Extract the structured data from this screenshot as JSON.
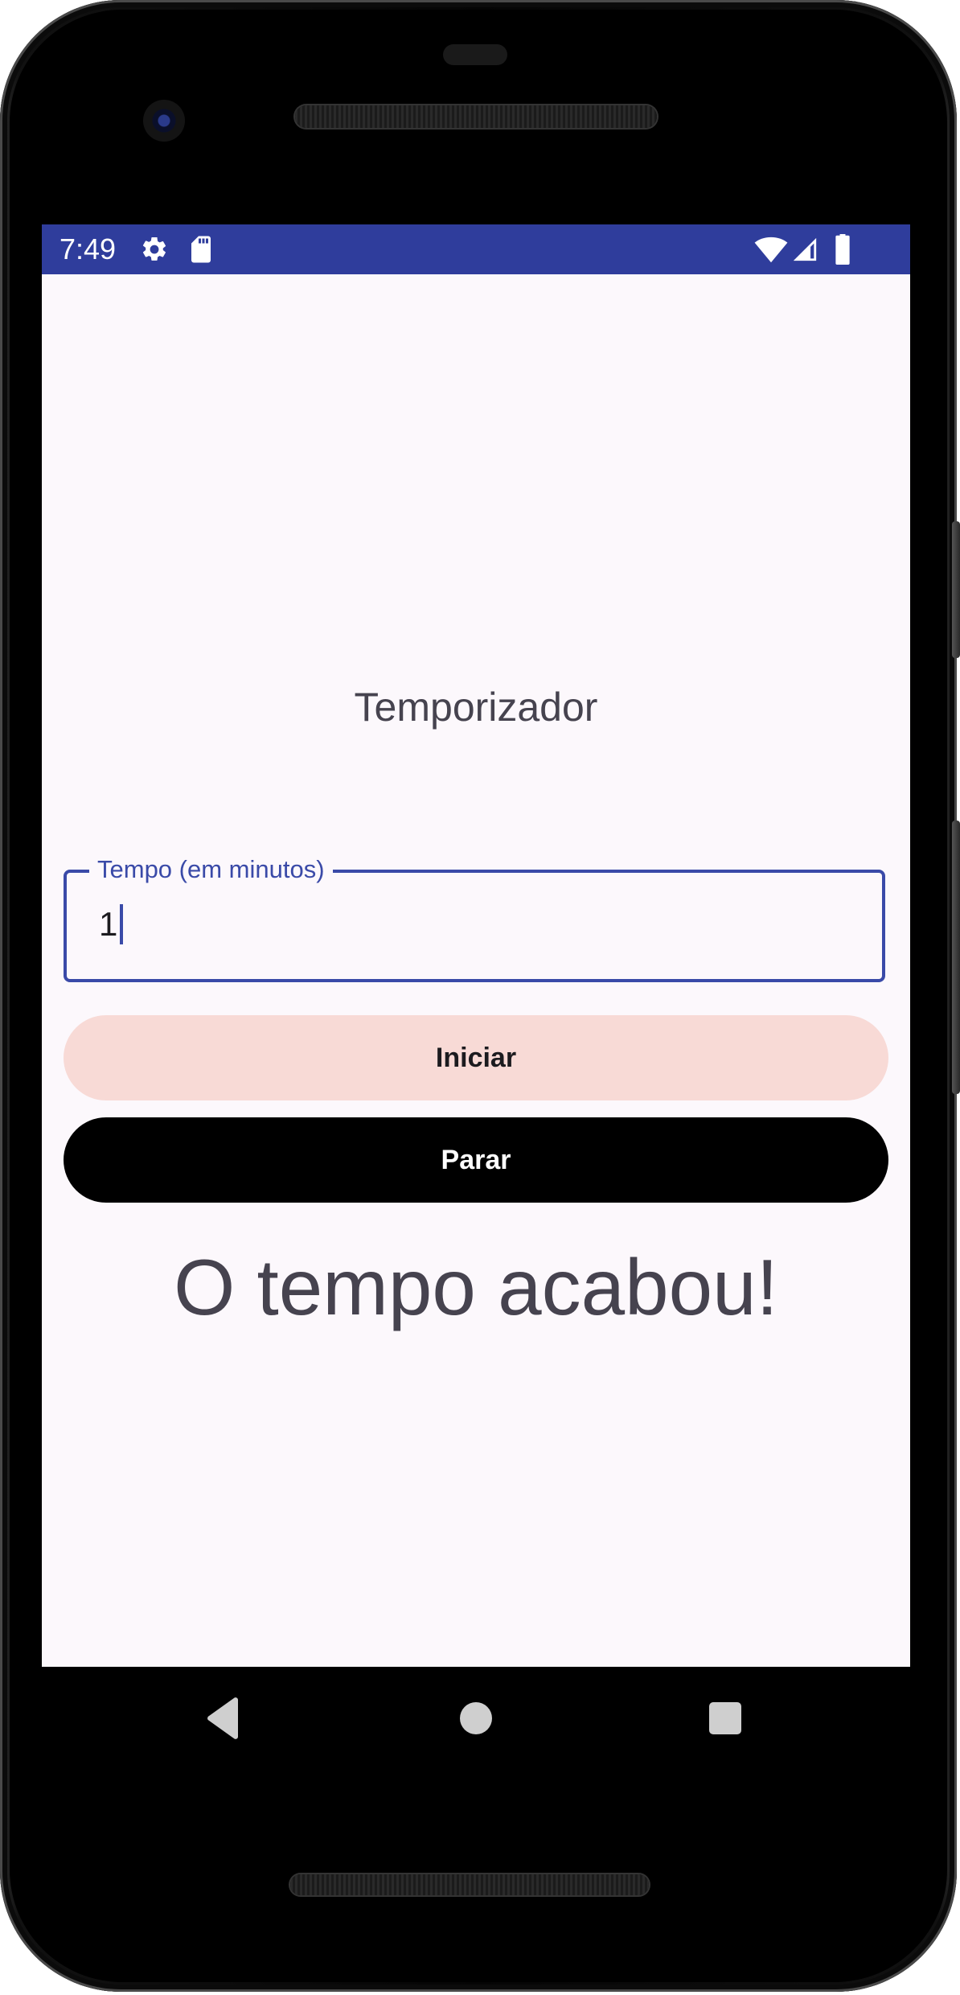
{
  "status_bar": {
    "time": "7:49",
    "icons": [
      "gear-icon",
      "sd-card-icon",
      "wifi-icon",
      "cell-signal-icon",
      "battery-icon"
    ]
  },
  "app": {
    "title": "Temporizador",
    "time_field": {
      "label": "Tempo (em minutos)",
      "value": "1"
    },
    "start_button": "Iniciar",
    "stop_button": "Parar",
    "message": "O tempo acabou!"
  },
  "nav_bar": {
    "icons": [
      "back-icon",
      "home-icon",
      "recents-icon"
    ]
  },
  "colors": {
    "status_bar": "#2f3d9c",
    "accent": "#3a4aa8",
    "background": "#fcf8fc",
    "start_button": "#f8dad6",
    "stop_button": "#000000"
  }
}
